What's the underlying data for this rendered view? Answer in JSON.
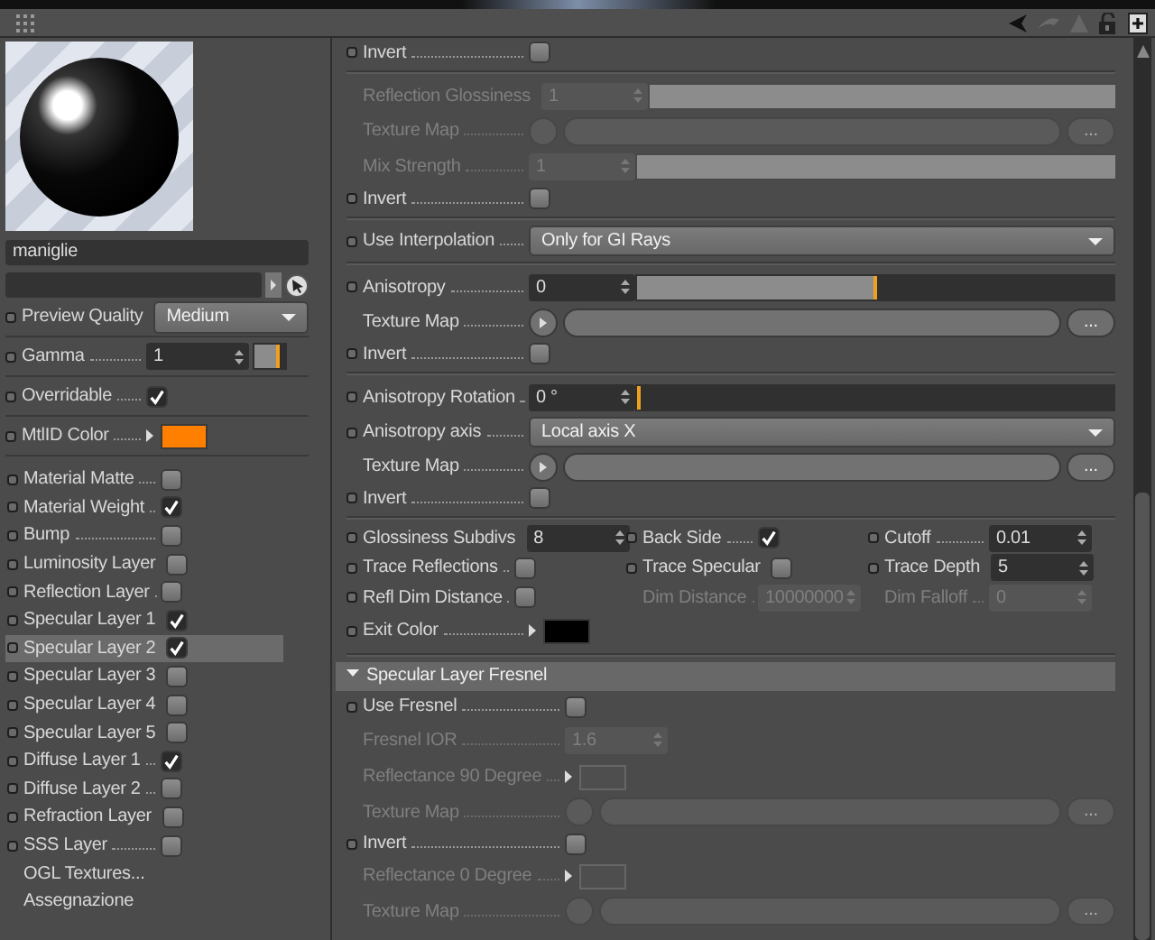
{
  "material": {
    "name": "maniglie"
  },
  "left_settings": [
    {
      "kind": "dropdown",
      "label": "Preview Quality",
      "value": "Medium",
      "port": true
    },
    {
      "kind": "slider",
      "label": "Gamma",
      "value": "1",
      "level": 0.75,
      "port": true
    },
    {
      "kind": "check",
      "label": "Overridable",
      "checked": true,
      "port": true
    },
    {
      "kind": "color",
      "label": "MtlID Color",
      "color": "#ff8000",
      "port": true
    }
  ],
  "layers": [
    {
      "kind": "check",
      "label": "Material Matte",
      "checked": false,
      "selected": false
    },
    {
      "kind": "check",
      "label": "Material Weight",
      "checked": true,
      "selected": false
    },
    {
      "kind": "check",
      "label": "Bump",
      "checked": false,
      "selected": false
    },
    {
      "kind": "check",
      "label": "Luminosity Layer",
      "checked": false,
      "selected": false
    },
    {
      "kind": "check",
      "label": "Reflection Layer",
      "checked": false,
      "selected": false
    },
    {
      "kind": "check",
      "label": "Specular Layer 1",
      "checked": true,
      "selected": false
    },
    {
      "kind": "check",
      "label": "Specular Layer 2",
      "checked": true,
      "selected": true
    },
    {
      "kind": "check",
      "label": "Specular Layer 3",
      "checked": false,
      "selected": false
    },
    {
      "kind": "check",
      "label": "Specular Layer 4",
      "checked": false,
      "selected": false
    },
    {
      "kind": "check",
      "label": "Specular Layer 5",
      "checked": false,
      "selected": false
    },
    {
      "kind": "check",
      "label": "Diffuse Layer 1",
      "checked": true,
      "selected": false
    },
    {
      "kind": "check",
      "label": "Diffuse Layer 2",
      "checked": false,
      "selected": false
    },
    {
      "kind": "check",
      "label": "Refraction Layer",
      "checked": false,
      "selected": false
    },
    {
      "kind": "check",
      "label": "SSS Layer",
      "checked": false,
      "selected": false
    },
    {
      "kind": "link",
      "label": "OGL Textures...",
      "selected": false
    },
    {
      "kind": "link",
      "label": "Assegnazione",
      "selected": false
    }
  ],
  "attributes": [
    {
      "kind": "check",
      "label": "Invert",
      "checked": false,
      "port": true,
      "disabled": false
    },
    {
      "kind": "divider"
    },
    {
      "kind": "slider",
      "label": "Reflection Glossiness",
      "value": "1",
      "level": 1,
      "port": false,
      "disabled": true
    },
    {
      "kind": "texture",
      "label": "Texture Map",
      "button": "...",
      "port": false,
      "disabled": true
    },
    {
      "kind": "slider",
      "label": "Mix Strength",
      "value": "1",
      "level": 1,
      "port": false,
      "disabled": true
    },
    {
      "kind": "check",
      "label": "Invert",
      "checked": false,
      "port": true,
      "disabled": false
    },
    {
      "kind": "divider"
    },
    {
      "kind": "dropdown",
      "label": "Use Interpolation",
      "value": "Only for GI Rays",
      "port": true,
      "disabled": false
    },
    {
      "kind": "divider"
    },
    {
      "kind": "slider",
      "label": "Anisotropy",
      "value": "0",
      "level": 0.5,
      "port": true,
      "disabled": false
    },
    {
      "kind": "texture",
      "label": "Texture Map",
      "button": "...",
      "port": false,
      "disabled": false
    },
    {
      "kind": "check",
      "label": "Invert",
      "checked": false,
      "port": true,
      "disabled": false
    },
    {
      "kind": "divider"
    },
    {
      "kind": "slider",
      "label": "Anisotropy Rotation",
      "value": "0 °",
      "level": 0,
      "port": true,
      "disabled": false
    },
    {
      "kind": "dropdown",
      "label": "Anisotropy axis",
      "value": "Local axis X",
      "port": true,
      "disabled": false
    },
    {
      "kind": "texture",
      "label": "Texture Map",
      "button": "...",
      "port": false,
      "disabled": false
    },
    {
      "kind": "check",
      "label": "Invert",
      "checked": false,
      "port": true,
      "disabled": false
    },
    {
      "kind": "divider"
    },
    {
      "kind": "triple",
      "cells": [
        {
          "kind": "spin",
          "label": "Glossiness Subdivs",
          "value": "8",
          "port": true,
          "disabled": false
        },
        {
          "kind": "check",
          "label": "Back Side",
          "checked": true,
          "port": true,
          "disabled": false
        },
        {
          "kind": "spin",
          "label": "Cutoff",
          "value": "0.01",
          "port": true,
          "disabled": false
        }
      ]
    },
    {
      "kind": "triple",
      "cells": [
        {
          "kind": "check",
          "label": "Trace Reflections",
          "checked": false,
          "port": true,
          "disabled": false
        },
        {
          "kind": "check",
          "label": "Trace Specular",
          "checked": false,
          "port": true,
          "disabled": false
        },
        {
          "kind": "spin",
          "label": "Trace Depth",
          "value": "5",
          "port": true,
          "disabled": false
        }
      ]
    },
    {
      "kind": "triple",
      "cells": [
        {
          "kind": "check",
          "label": "Refl Dim Distance",
          "checked": false,
          "port": true,
          "disabled": false
        },
        {
          "kind": "spin",
          "label": "Dim Distance",
          "value": "10000000",
          "port": false,
          "disabled": true
        },
        {
          "kind": "spin",
          "label": "Dim Falloff",
          "value": "0",
          "port": false,
          "disabled": true
        }
      ]
    },
    {
      "kind": "color",
      "label": "Exit Color",
      "color": "#000000",
      "port": true,
      "disabled": false
    },
    {
      "kind": "divider"
    },
    {
      "kind": "section",
      "label": "Specular Layer Fresnel",
      "expanded": true,
      "children": [
        {
          "kind": "check",
          "label": "Use Fresnel",
          "checked": false,
          "port": true,
          "disabled": false
        },
        {
          "kind": "spin",
          "label": "Fresnel IOR",
          "value": "1.6",
          "port": false,
          "disabled": true
        },
        {
          "kind": "color",
          "label": "Reflectance 90 Degree",
          "color": "#4e4e4e",
          "port": false,
          "disabled": true
        },
        {
          "kind": "texture",
          "label": "Texture Map",
          "button": "...",
          "port": false,
          "disabled": true
        },
        {
          "kind": "check",
          "label": "Invert",
          "checked": false,
          "port": true,
          "disabled": false
        },
        {
          "kind": "color",
          "label": "Reflectance 0 Degree",
          "color": "#4e4e4e",
          "port": false,
          "disabled": true
        },
        {
          "kind": "texture",
          "label": "Texture Map",
          "button": "...",
          "port": false,
          "disabled": true
        }
      ]
    }
  ]
}
